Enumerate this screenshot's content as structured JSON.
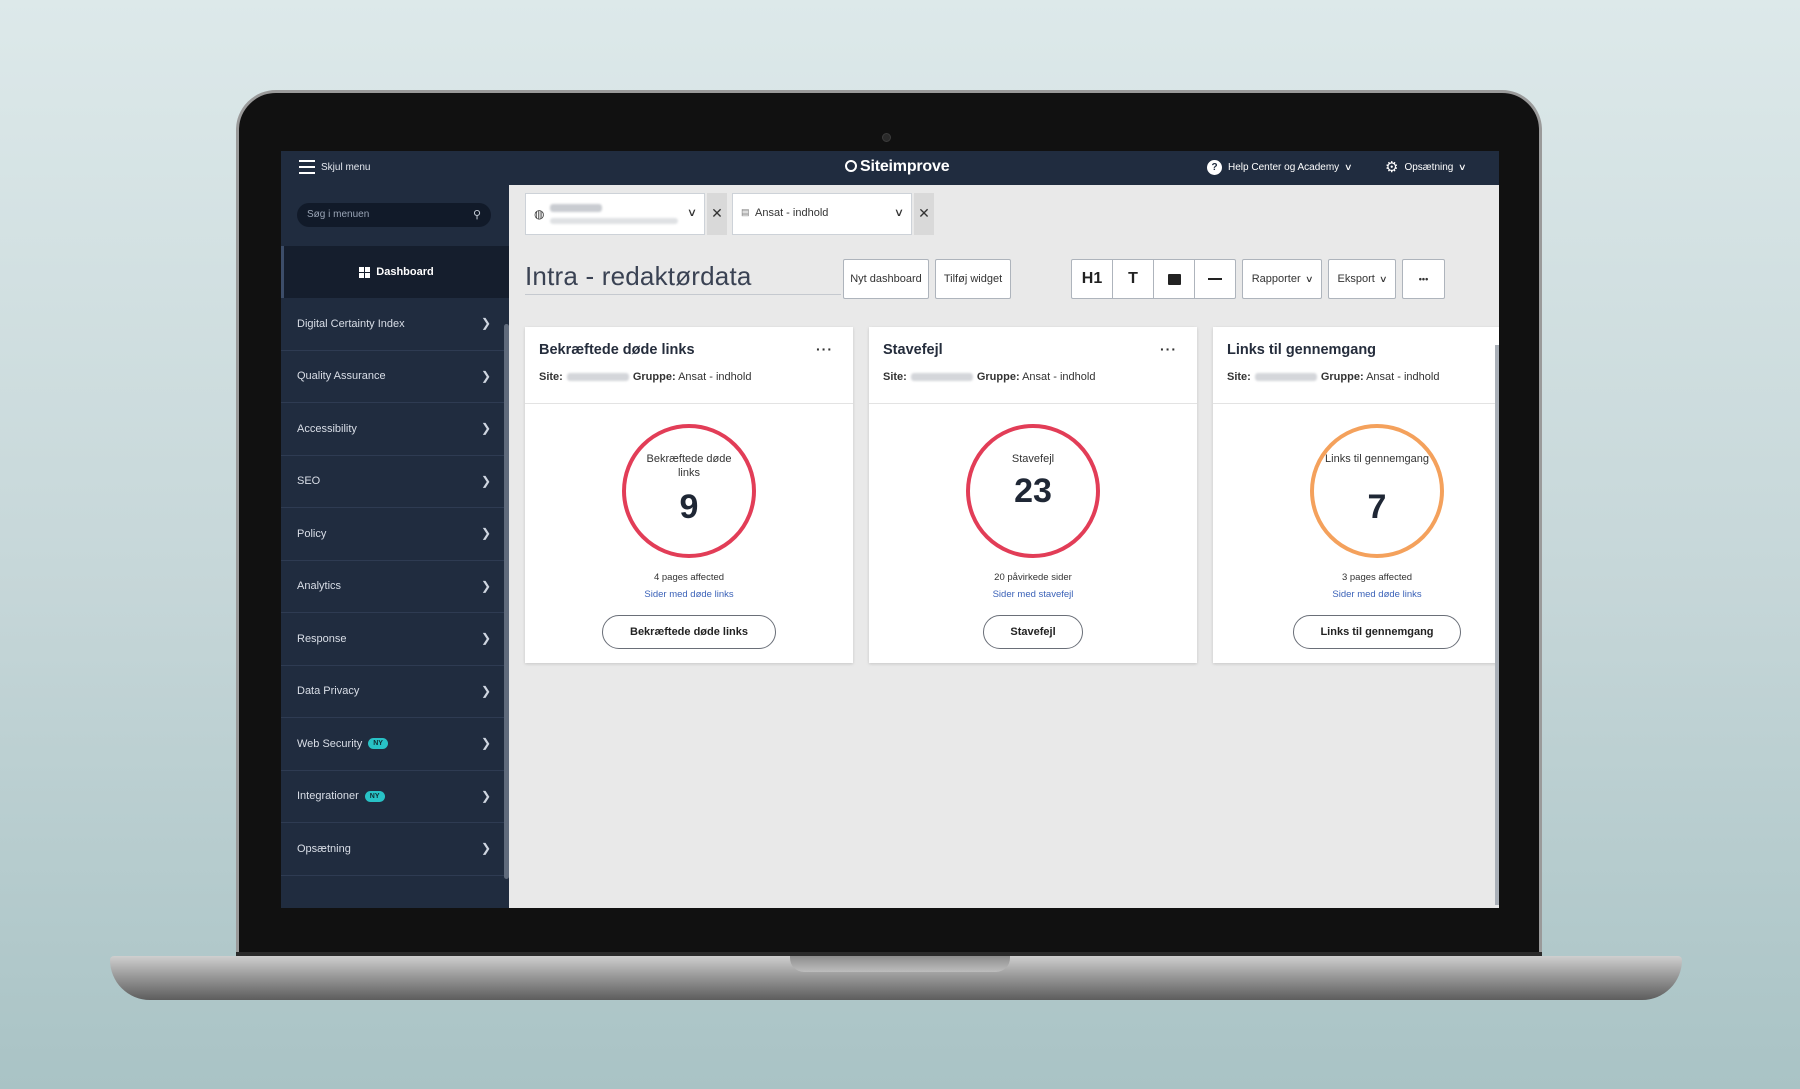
{
  "topbar": {
    "hide_menu": "Skjul menu",
    "brand": "Siteimprove",
    "help": "Help Center og Academy",
    "setup": "Opsætning"
  },
  "sidebar": {
    "search_placeholder": "Søg i menuen",
    "dashboard": "Dashboard",
    "items": [
      {
        "label": "Digital Certainty Index"
      },
      {
        "label": "Quality Assurance"
      },
      {
        "label": "Accessibility"
      },
      {
        "label": "SEO"
      },
      {
        "label": "Policy"
      },
      {
        "label": "Analytics"
      },
      {
        "label": "Response"
      },
      {
        "label": "Data Privacy"
      },
      {
        "label": "Web Security",
        "badge": "NY"
      },
      {
        "label": "Integrationer",
        "badge": "NY"
      },
      {
        "label": "Opsætning"
      }
    ]
  },
  "filters": {
    "group": "Ansat - indhold"
  },
  "page": {
    "title": "Intra - redaktørdata"
  },
  "toolbar": {
    "new_dashboard": "Nyt dashboard",
    "add_widget": "Tilføj widget",
    "h1": "H1",
    "text": "T",
    "reports": "Rapporter",
    "export": "Eksport",
    "more": "•••"
  },
  "cards": [
    {
      "title": "Bekræftede døde links",
      "site_label": "Site:",
      "group_label": "Gruppe:",
      "group": "Ansat - indhold",
      "ring_label": "Bekræftede døde links",
      "value": "9",
      "affected": "4 pages affected",
      "link": "Sider med døde links",
      "button": "Bekræftede døde links",
      "color": "#e23d57"
    },
    {
      "title": "Stavefejl",
      "site_label": "Site:",
      "group_label": "Gruppe:",
      "group": "Ansat - indhold",
      "ring_label": "Stavefejl",
      "value": "23",
      "affected": "20 påvirkede sider",
      "link": "Sider med stavefejl",
      "button": "Stavefejl",
      "color": "#e23d57"
    },
    {
      "title": "Links til gennemgang",
      "site_label": "Site:",
      "group_label": "Gruppe:",
      "group": "Ansat - indhold",
      "ring_label": "Links til gennemgang",
      "value": "7",
      "affected": "3 pages affected",
      "link": "Sider med døde links",
      "button": "Links til gennemgang",
      "color": "#f4a15c"
    }
  ]
}
